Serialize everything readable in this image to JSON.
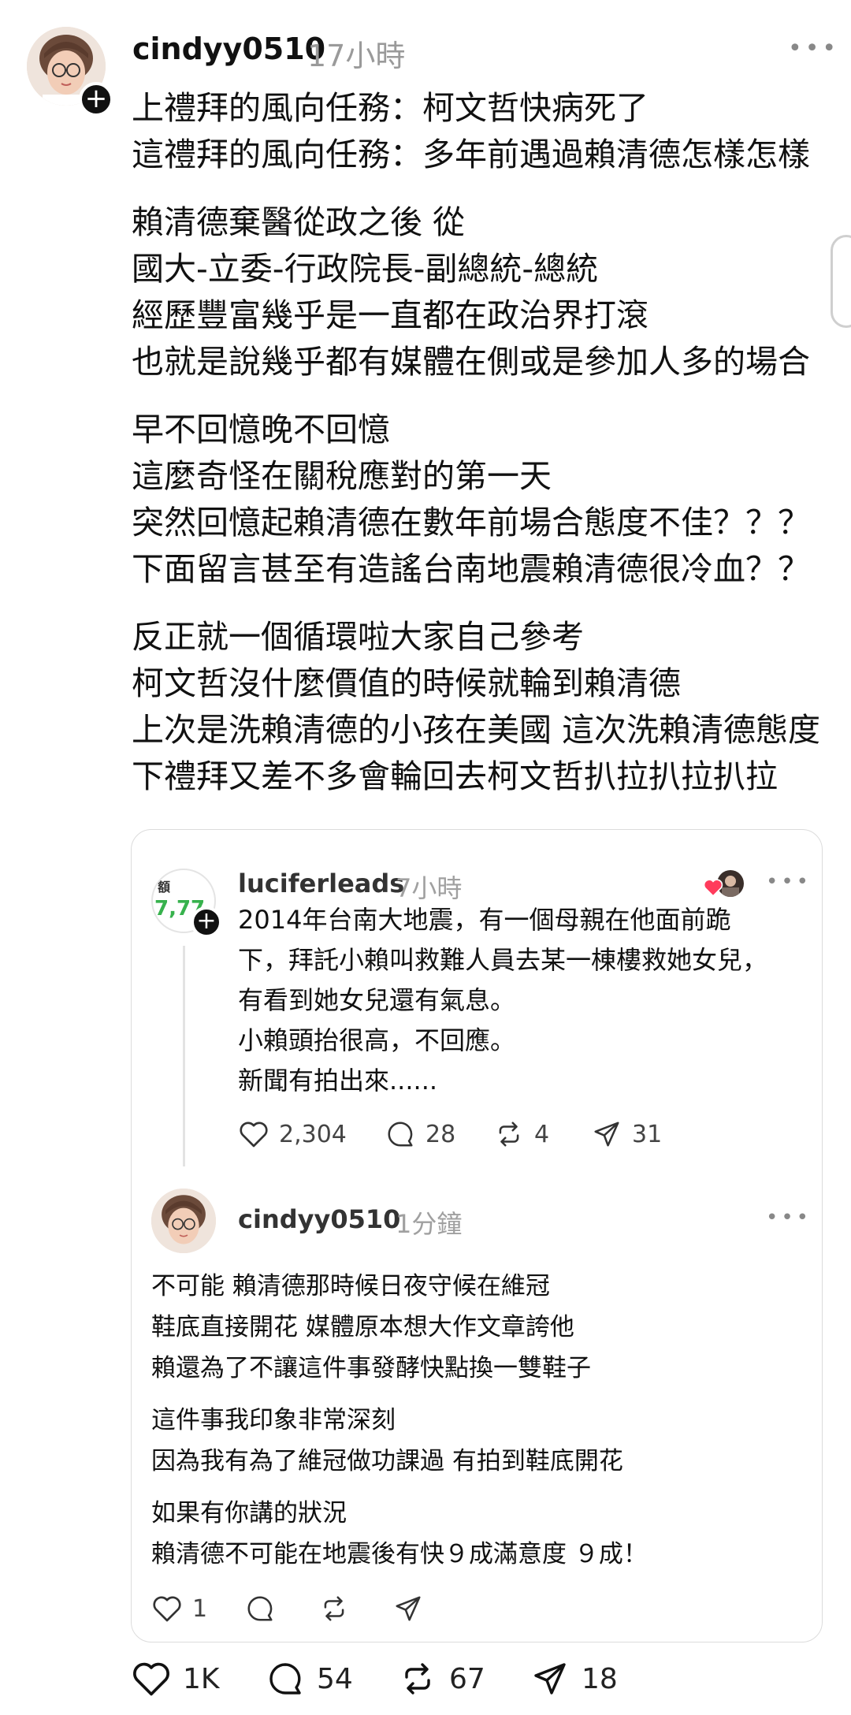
{
  "post": {
    "username": "cindyy0510",
    "time": "17小時",
    "paragraphs": [
      [
        "上禮拜的風向任務：柯文哲快病死了",
        "這禮拜的風向任務：多年前遇過賴清德怎樣怎樣"
      ],
      [
        "賴清德棄醫從政之後 從",
        "國大-立委-行政院長-副總統-總統",
        "經歷豐富幾乎是一直都在政治界打滾",
        "也就是說幾乎都有媒體在側或是參加人多的場合"
      ],
      [
        "早不回憶晚不回憶",
        "這麼奇怪在關稅應對的第一天",
        "突然回憶起賴清德在數年前場合態度不佳？？？",
        "下面留言甚至有造謠台南地震賴清德很冷血？？"
      ],
      [
        "反正就一個循環啦大家自己參考",
        "柯文哲沒什麼價值的時候就輪到賴清德",
        "上次是洗賴清德的小孩在美國 這次洗賴清德態度",
        "下禮拜又差不多會輪回去柯文哲扒拉扒拉扒拉"
      ]
    ],
    "stats": {
      "likes": "1K",
      "comments": "54",
      "reposts": "67",
      "shares": "18"
    }
  },
  "quoted": {
    "username": "luciferleads",
    "time": "7小時",
    "avatar_text": {
      "top": "額",
      "number": "7,77"
    },
    "lines": [
      "2014年台南大地震，有一個母親在他面前跪",
      "下，拜託小賴叫救難人員去某一棟樓救她女兒，",
      "有看到她女兒還有氣息。",
      "小賴頭抬很高，不回應。",
      "新聞有拍出來......"
    ],
    "stats": {
      "likes": "2,304",
      "comments": "28",
      "reposts": "4",
      "shares": "31"
    }
  },
  "reply": {
    "username": "cindyy0510",
    "time": "1分鐘",
    "paragraphs": [
      [
        "不可能 賴清德那時候日夜守候在維冠",
        "鞋底直接開花 媒體原本想大作文章誇他",
        "賴還為了不讓這件事發酵快點換一雙鞋子"
      ],
      [
        "這件事我印象非常深刻",
        "因為我有為了維冠做功課過 有拍到鞋底開花"
      ],
      [
        "如果有你講的狀況",
        "賴清德不可能在地震後有快９成滿意度 ９成！"
      ]
    ],
    "stats": {
      "likes": "1"
    }
  },
  "colors": {
    "heart_badge": "#ff3b5c",
    "number_green": "#37b24d"
  },
  "icons": [
    "heart-icon",
    "comment-icon",
    "repost-icon",
    "share-icon",
    "more-icon",
    "plus-icon"
  ]
}
